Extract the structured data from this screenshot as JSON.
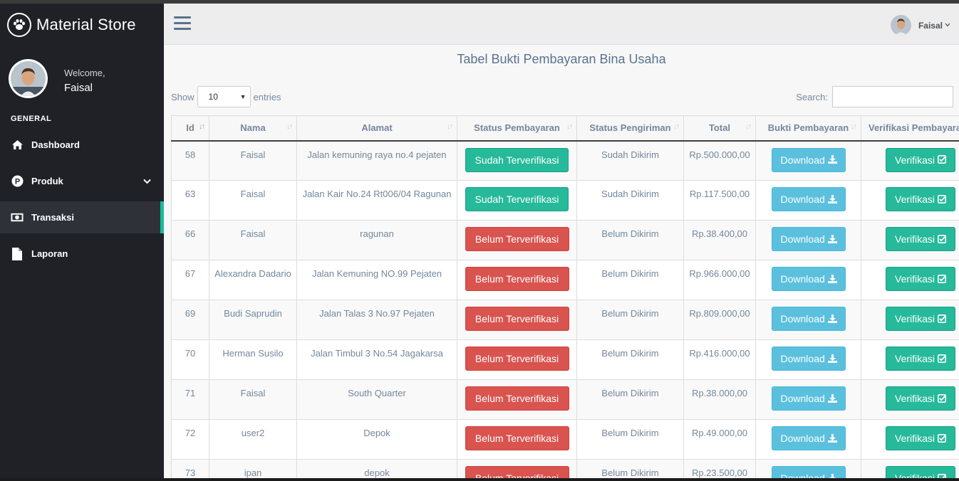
{
  "app": {
    "brand": "Material Store",
    "welcome": "Welcome,",
    "user": "Faisal"
  },
  "sidebar": {
    "section": "GENERAL",
    "items": [
      {
        "label": "Dashboard",
        "icon": "home-icon"
      },
      {
        "label": "Produk",
        "icon": "product-icon"
      },
      {
        "label": "Transaksi",
        "icon": "money-icon"
      },
      {
        "label": "Laporan",
        "icon": "file-icon"
      }
    ]
  },
  "topnav": {
    "user": "Faisal"
  },
  "page": {
    "title": "Tabel Bukti Pembayaran Bina Usaha",
    "show_label": "Show",
    "entries_value": "10",
    "entries_label": "entries",
    "search_label": "Search:",
    "search_value": ""
  },
  "table": {
    "columns": [
      "Id",
      "Nama",
      "Alamat",
      "Status Pembayaran",
      "Status Pengiriman",
      "Total",
      "Bukti Pembayaran",
      "Verifikasi Pembayaran"
    ],
    "download_label": "Download",
    "verify_label": "Verifikasi",
    "rows": [
      {
        "id": "58",
        "nama": "Faisal",
        "alamat": "Jalan kemuning raya no.4 pejaten",
        "status": "Sudah Terverifikasi",
        "verified": true,
        "kirim": "Sudah Dikirim",
        "total": "Rp.500.000,00"
      },
      {
        "id": "63",
        "nama": "Faisal",
        "alamat": "Jalan Kair No.24 Rt006/04 Ragunan",
        "status": "Sudah Terverifikasi",
        "verified": true,
        "kirim": "Sudah Dikirim",
        "total": "Rp.117.500,00"
      },
      {
        "id": "66",
        "nama": "Faisal",
        "alamat": "ragunan",
        "status": "Belum Terverifikasi",
        "verified": false,
        "kirim": "Belum Dikirim",
        "total": "Rp.38.400,00"
      },
      {
        "id": "67",
        "nama": "Alexandra Dadario",
        "alamat": "Jalan Kemuning NO.99 Pejaten",
        "status": "Belum Terverifikasi",
        "verified": false,
        "kirim": "Belum Dikirim",
        "total": "Rp.966.000,00"
      },
      {
        "id": "69",
        "nama": "Budi Saprudin",
        "alamat": "Jalan Talas 3 No.97 Pejaten",
        "status": "Belum Terverifikasi",
        "verified": false,
        "kirim": "Belum Dikirim",
        "total": "Rp.809.000,00"
      },
      {
        "id": "70",
        "nama": "Herman Susilo",
        "alamat": "Jalan Timbul 3 No.54 Jagakarsa",
        "status": "Belum Terverifikasi",
        "verified": false,
        "kirim": "Belum Dikirim",
        "total": "Rp.416.000,00"
      },
      {
        "id": "71",
        "nama": "Faisal",
        "alamat": "South Quarter",
        "status": "Belum Terverifikasi",
        "verified": false,
        "kirim": "Belum Dikirim",
        "total": "Rp.38.000,00"
      },
      {
        "id": "72",
        "nama": "user2",
        "alamat": "Depok",
        "status": "Belum Terverifikasi",
        "verified": false,
        "kirim": "Belum Dikirim",
        "total": "Rp.49.000,00"
      },
      {
        "id": "73",
        "nama": "ipan",
        "alamat": "depok",
        "status": "Belum Terverifikasi",
        "verified": false,
        "kirim": "Belum Dikirim",
        "total": "Rp.23.500,00"
      }
    ]
  },
  "colors": {
    "sidebar": "#1f2126",
    "accent": "#1ABB9C",
    "success": "#26B99A",
    "danger": "#D9534F",
    "info": "#5BC0DE"
  }
}
